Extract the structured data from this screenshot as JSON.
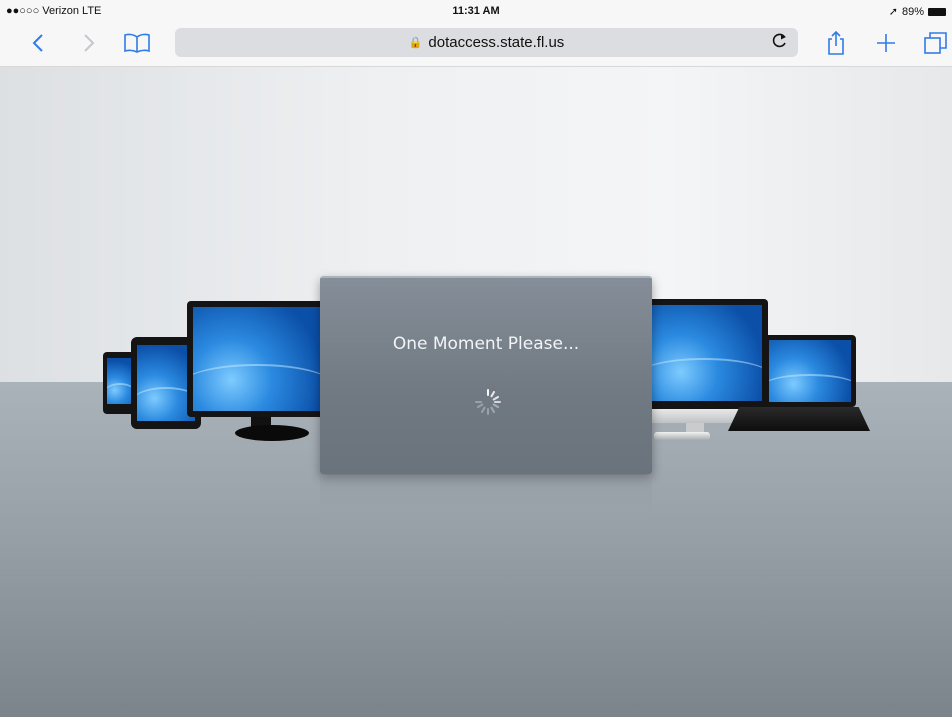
{
  "status_bar": {
    "carrier": "●●○○○ Verizon  LTE",
    "time": "11:31 AM",
    "battery": "89%"
  },
  "browser": {
    "url": "dotaccess.state.fl.us",
    "icons": {
      "back": "chevron-left-icon",
      "forward": "chevron-right-icon",
      "bookmarks": "book-icon",
      "lock": "lock-icon",
      "reload": "reload-icon",
      "share": "share-icon",
      "new_tab": "plus-icon",
      "tabs": "tabs-icon"
    },
    "accent_color": "#2f7ce6"
  },
  "loading": {
    "message": "One Moment Please..."
  }
}
